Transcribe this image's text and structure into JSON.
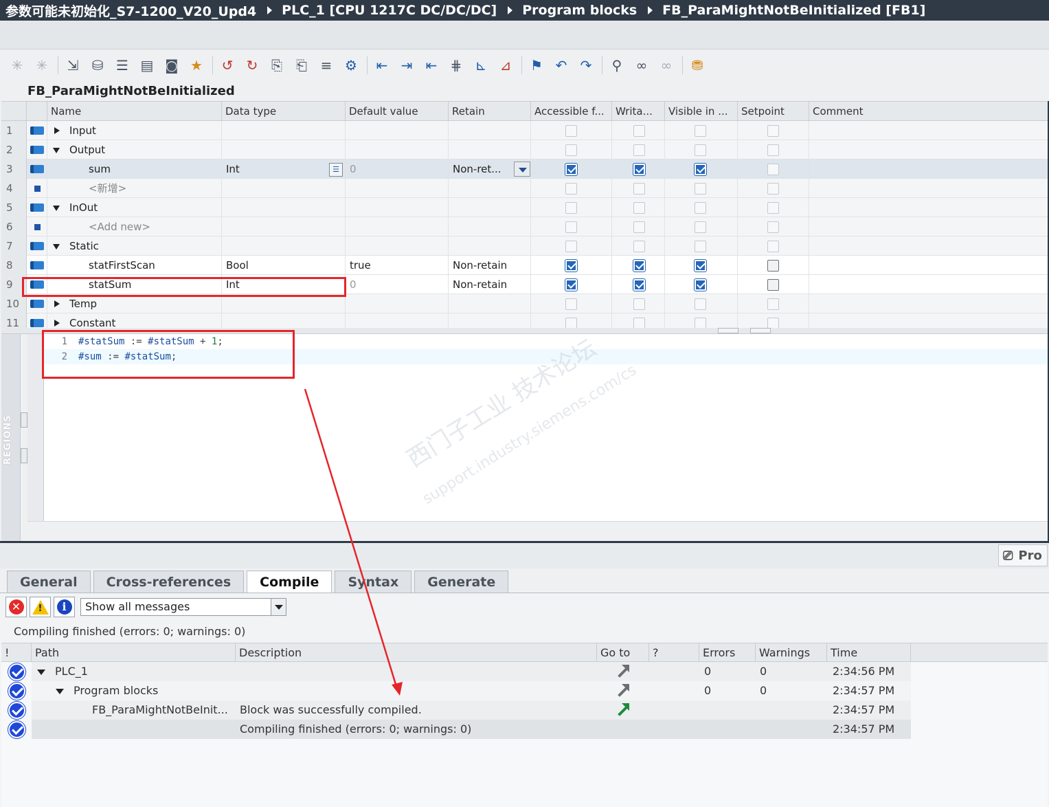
{
  "titlebar": {
    "crumbs": [
      "参数可能未初始化_S7-1200_V20_Upd4",
      "PLC_1 [CPU 1217C DC/DC/DC]",
      "Program blocks",
      "FB_ParaMightNotBeInitialized [FB1]"
    ]
  },
  "block_title": "FB_ParaMightNotBeInitialized",
  "interface": {
    "columns": [
      "Name",
      "Data type",
      "Default value",
      "Retain",
      "Accessible f...",
      "Writa...",
      "Visible in ...",
      "Setpoint",
      "Comment"
    ],
    "rows": [
      {
        "num": "1",
        "name": "Input",
        "type": "",
        "default": "",
        "retain": "",
        "acc": false,
        "wr": false,
        "vis": false,
        "sp": false
      },
      {
        "num": "2",
        "name": "Output",
        "type": "",
        "default": "",
        "retain": "",
        "acc": false,
        "wr": false,
        "vis": false,
        "sp": false
      },
      {
        "num": "3",
        "name": "sum",
        "type": "Int",
        "default": "0",
        "retain": "Non-ret...",
        "acc": true,
        "wr": true,
        "vis": true,
        "sp": false
      },
      {
        "num": "4",
        "name": "<新增>",
        "type": "",
        "default": "",
        "retain": "",
        "acc": false,
        "wr": false,
        "vis": false,
        "sp": false
      },
      {
        "num": "5",
        "name": "InOut",
        "type": "",
        "default": "",
        "retain": "",
        "acc": false,
        "wr": false,
        "vis": false,
        "sp": false
      },
      {
        "num": "6",
        "name": "<Add new>",
        "type": "",
        "default": "",
        "retain": "",
        "acc": false,
        "wr": false,
        "vis": false,
        "sp": false
      },
      {
        "num": "7",
        "name": "Static",
        "type": "",
        "default": "",
        "retain": "",
        "acc": false,
        "wr": false,
        "vis": false,
        "sp": false
      },
      {
        "num": "8",
        "name": "statFirstScan",
        "type": "Bool",
        "default": "true",
        "retain": "Non-retain",
        "acc": true,
        "wr": true,
        "vis": true,
        "sp": false
      },
      {
        "num": "9",
        "name": "statSum",
        "type": "Int",
        "default": "0",
        "retain": "Non-retain",
        "acc": true,
        "wr": true,
        "vis": true,
        "sp": false
      },
      {
        "num": "10",
        "name": "Temp",
        "type": "",
        "default": "",
        "retain": "",
        "acc": false,
        "wr": false,
        "vis": false,
        "sp": false
      },
      {
        "num": "11",
        "name": "Constant",
        "type": "",
        "default": "",
        "retain": "",
        "acc": false,
        "wr": false,
        "vis": false,
        "sp": false
      }
    ]
  },
  "editor": {
    "regions_label": "REGIONS",
    "lines": [
      {
        "num": "1",
        "a": "#statSum",
        "b": " := ",
        "c": "#statSum",
        "d": " + ",
        "e": "1",
        "f": ";"
      },
      {
        "num": "2",
        "a": "#sum",
        "b": " := ",
        "c": "#statSum",
        "d": ";",
        "e": "",
        "f": ""
      }
    ],
    "watermark": "西门子工业  技术论坛",
    "watermark_url": "support.industry.siemens.com/cs"
  },
  "inspector": {
    "pro_label": "Pro",
    "tabs": [
      "General",
      "Cross-references",
      "Compile",
      "Syntax",
      "Generate"
    ],
    "active_tab": "Compile",
    "filter_value": "Show all messages",
    "status": "Compiling finished (errors: 0; warnings: 0)",
    "columns": [
      "!",
      "Path",
      "Description",
      "Go to",
      "?",
      "Errors",
      "Warnings",
      "Time"
    ],
    "rows": [
      {
        "path": "PLC_1",
        "desc": "",
        "errors": "0",
        "warnings": "0",
        "time": "2:34:56 PM"
      },
      {
        "path": "Program blocks",
        "desc": "",
        "errors": "0",
        "warnings": "0",
        "time": "2:34:57 PM"
      },
      {
        "path": "FB_ParaMightNotBeInit...",
        "desc": "Block was successfully compiled.",
        "errors": "",
        "warnings": "",
        "time": "2:34:57 PM"
      },
      {
        "path": "",
        "desc": "Compiling finished (errors: 0; warnings: 0)",
        "errors": "",
        "warnings": "",
        "time": "2:34:57 PM"
      }
    ]
  },
  "colors": {
    "titlebar": "#2f3a46",
    "highlight": "#e5252a",
    "check": "#2566b8",
    "ok": "#1e48d8"
  }
}
